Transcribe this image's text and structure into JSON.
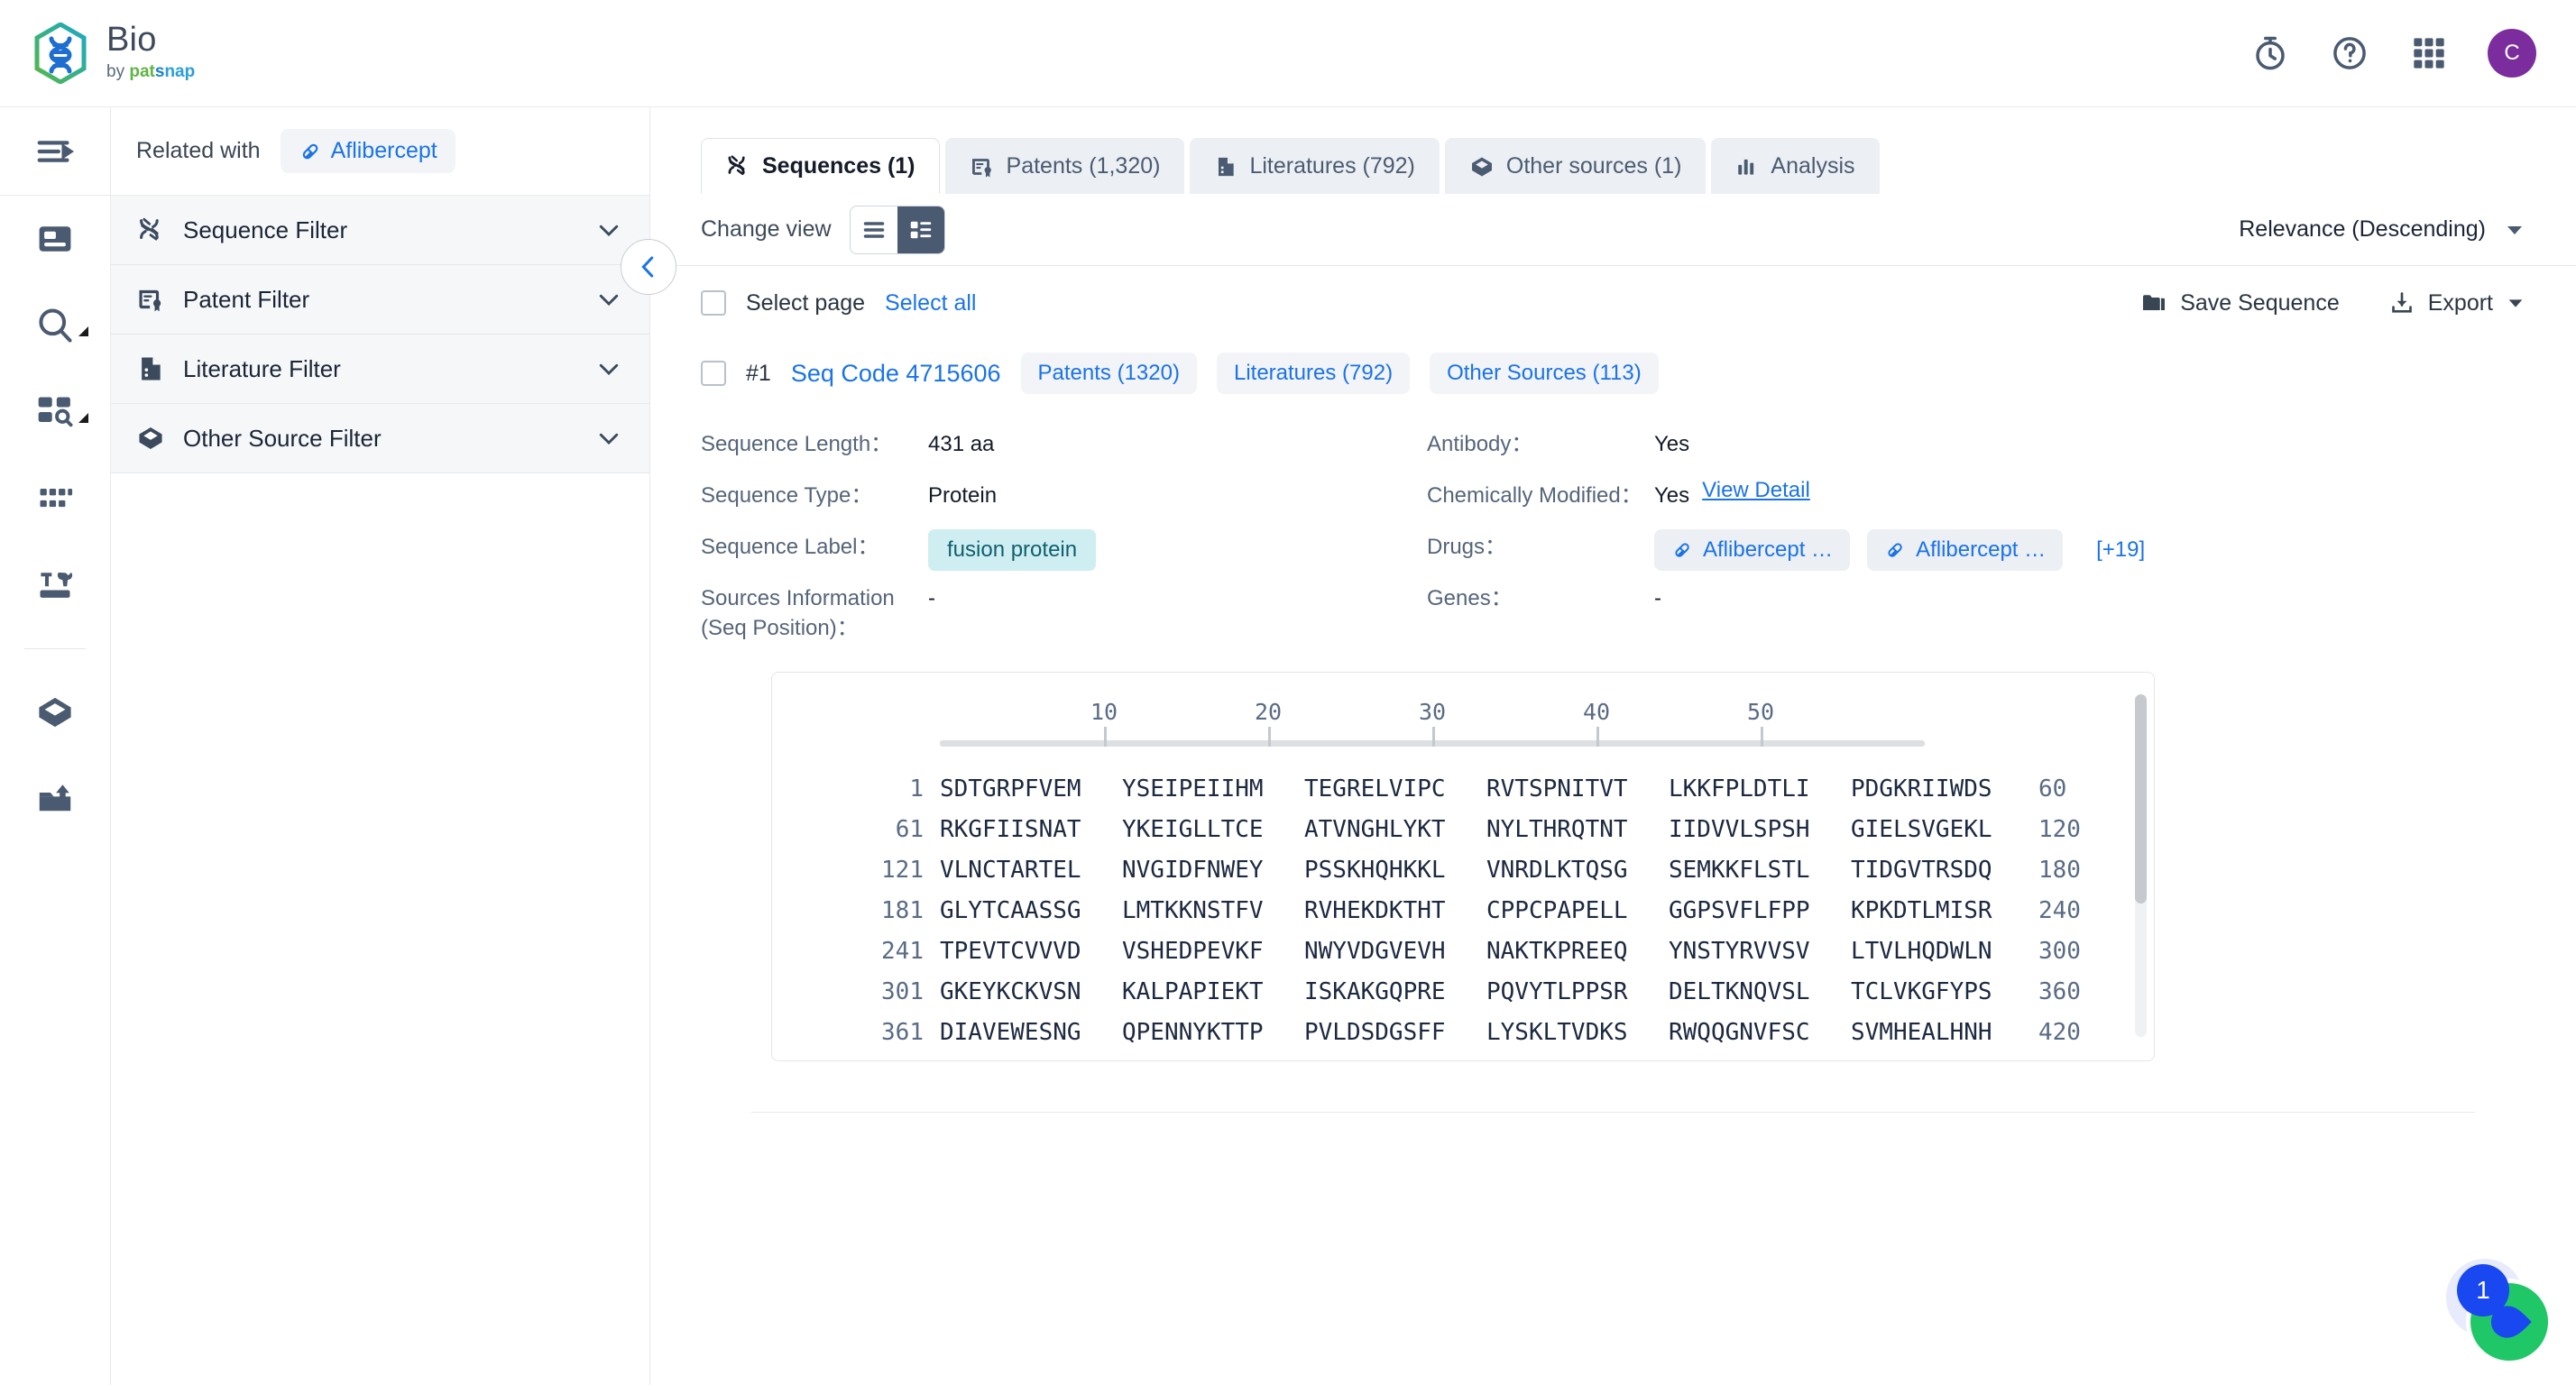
{
  "brand": {
    "title": "Bio",
    "by": "by",
    "pat": "pat",
    "s": "s",
    "nap": "nap",
    "logo_gradient_from": "#5cb848",
    "logo_gradient_to": "#1fa8c4"
  },
  "topbar": {
    "icons": [
      "stopwatch-icon",
      "help-icon",
      "apps-grid-icon"
    ],
    "avatar_initial": "C",
    "avatar_color": "#7b2d9e"
  },
  "rail": {
    "toggle": "expand-sidebar-icon",
    "items": [
      {
        "icon": "document-card-icon",
        "caret": false
      },
      {
        "icon": "search-icon",
        "caret": true
      },
      {
        "icon": "grid-search-icon",
        "caret": true
      },
      {
        "icon": "dots-grid-icon",
        "caret": false
      },
      {
        "icon": "tools-icon",
        "caret": false
      },
      {
        "icon": "layers-box-icon",
        "caret": false
      },
      {
        "icon": "upload-inbox-icon",
        "caret": false
      }
    ]
  },
  "related": {
    "label": "Related with",
    "chip": "Aflibercept"
  },
  "filters": [
    {
      "label": "Sequence Filter",
      "icon": "dna-icon"
    },
    {
      "label": "Patent Filter",
      "icon": "patent-icon"
    },
    {
      "label": "Literature Filter",
      "icon": "literature-icon"
    },
    {
      "label": "Other Source Filter",
      "icon": "other-source-icon"
    }
  ],
  "tabs": [
    {
      "label": "Sequences (1)",
      "icon": "dna-icon",
      "active": true
    },
    {
      "label": "Patents (1,320)",
      "icon": "patent-icon",
      "active": false
    },
    {
      "label": "Literatures (792)",
      "icon": "literature-icon",
      "active": false
    },
    {
      "label": "Other sources (1)",
      "icon": "other-source-icon",
      "active": false
    },
    {
      "label": "Analysis",
      "icon": "bar-chart-icon",
      "active": false
    }
  ],
  "viewbar": {
    "change_view_label": "Change view",
    "list_view_icon": "list-view-icon",
    "card_view_icon": "card-view-icon",
    "active_view": "card",
    "sort_value": "Relevance (Descending)"
  },
  "selectbar": {
    "select_page": "Select page",
    "select_all": "Select all",
    "save_sequence": "Save Sequence",
    "export": "Export"
  },
  "result": {
    "index": "#1",
    "code": "Seq Code 4715606",
    "chips": [
      "Patents (1320)",
      "Literatures (792)",
      "Other Sources (113)"
    ],
    "fields_left": [
      {
        "key": "Sequence Length：",
        "value": "431 aa",
        "type": "text"
      },
      {
        "key": "Sequence Type：",
        "value": "Protein",
        "type": "text"
      },
      {
        "key": "Sequence Label：",
        "value": "fusion protein",
        "type": "chip"
      },
      {
        "key": "Sources Information\n(Seq Position)：",
        "value": "-",
        "type": "text"
      }
    ],
    "fields_right": [
      {
        "key": "Antibody：",
        "value": "Yes",
        "type": "text"
      },
      {
        "key": "Chemically Modified：",
        "value": "Yes",
        "link": "View Detail",
        "type": "link"
      },
      {
        "key": "Drugs：",
        "drugs": [
          "Aflibercept …",
          "Aflibercept …"
        ],
        "more": "[+19]",
        "type": "drugs"
      },
      {
        "key": "Genes：",
        "value": "-",
        "type": "text"
      }
    ]
  },
  "sequence_viewer": {
    "ruler_labels": [
      10,
      20,
      30,
      40,
      50
    ],
    "rows": [
      {
        "start": "1",
        "chunks": [
          "SDTGRPFVEM",
          "YSEIPEIIHM",
          "TEGRELVIPC",
          "RVTSPNITVT",
          "LKKFPLDTLI",
          "PDGKRIIWDS"
        ],
        "end": "60"
      },
      {
        "start": "61",
        "chunks": [
          "RKGFIISNAT",
          "YKEIGLLTCE",
          "ATVNGHLYKT",
          "NYLTHRQTNT",
          "IIDVVLSPSH",
          "GIELSVGEKL"
        ],
        "end": "120"
      },
      {
        "start": "121",
        "chunks": [
          "VLNCTARTEL",
          "NVGIDFNWEY",
          "PSSKHQHKKL",
          "VNRDLKTQSG",
          "SEMKKFLSTL",
          "TIDGVTRSDQ"
        ],
        "end": "180"
      },
      {
        "start": "181",
        "chunks": [
          "GLYTCAASSG",
          "LMTKKNSTFV",
          "RVHEKDKTHT",
          "CPPCPAPELL",
          "GGPSVFLFPP",
          "KPKDTLMISR"
        ],
        "end": "240"
      },
      {
        "start": "241",
        "chunks": [
          "TPEVTCVVVD",
          "VSHEDPEVKF",
          "NWYVDGVEVH",
          "NAKTKPREEQ",
          "YNSTYRVVSV",
          "LTVLHQDWLN"
        ],
        "end": "300"
      },
      {
        "start": "301",
        "chunks": [
          "GKEYKCKVSN",
          "KALPAPIEKT",
          "ISKAKGQPRE",
          "PQVYTLPPSR",
          "DELTKNQVSL",
          "TCLVKGFYPS"
        ],
        "end": "360"
      },
      {
        "start": "361",
        "chunks": [
          "DIAVEWESNG",
          "QPENNYKTTP",
          "PVLDSDGSFF",
          "LYSKLTVDKS",
          "RWQQGNVFSC",
          "SVMHEALHNH"
        ],
        "end": "420"
      }
    ]
  },
  "chat": {
    "badge": "1",
    "color": "#20c767",
    "badge_color": "#1a48f0"
  },
  "colors": {
    "link": "#1a73e8",
    "icon_dark": "#4a5a70",
    "panel_bg": "#f5f7f9"
  }
}
